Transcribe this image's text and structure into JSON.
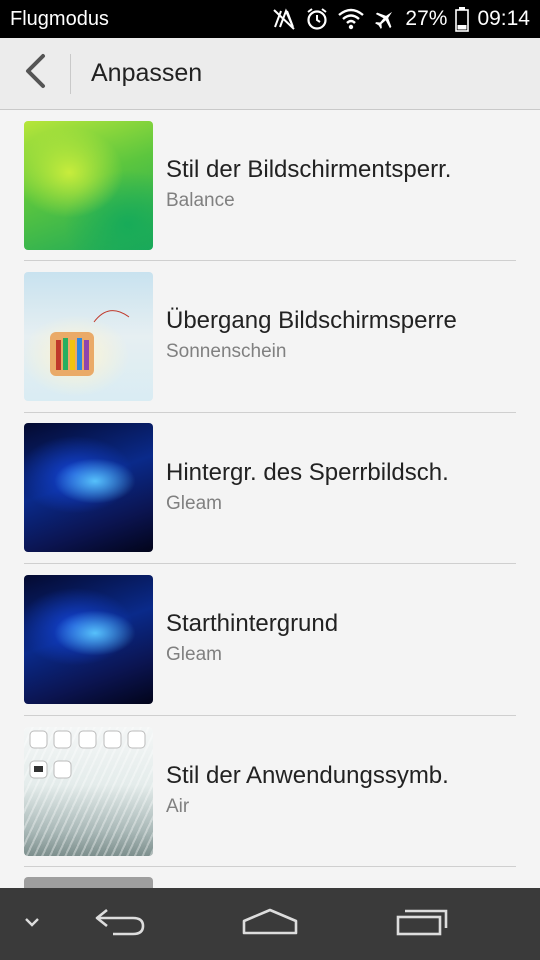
{
  "status_bar": {
    "carrier": "Flugmodus",
    "battery": "27%",
    "time": "09:14",
    "icons": [
      "nfc-icon",
      "alarm-icon",
      "wifi-icon",
      "airplane-icon",
      "battery-icon"
    ]
  },
  "app_bar": {
    "title": "Anpassen",
    "back_icon": "back-arrow-icon"
  },
  "items": [
    {
      "title": "Stil der Bildschirmentsperr.",
      "subtitle": "Balance",
      "thumb": "green-abstract"
    },
    {
      "title": "Übergang Bildschirmsperre",
      "subtitle": "Sonnenschein",
      "thumb": "pencils-sunshine"
    },
    {
      "title": "Hintergr. des Sperrbildsch.",
      "subtitle": "Gleam",
      "thumb": "blue-gleam"
    },
    {
      "title": "Starthintergrund",
      "subtitle": "Gleam",
      "thumb": "blue-gleam"
    },
    {
      "title": "Stil der Anwendungssymb.",
      "subtitle": "Air",
      "thumb": "air-icons"
    }
  ],
  "nav_bar": {
    "buttons": [
      "hide-keyboard-icon",
      "back-icon",
      "home-icon",
      "recents-icon"
    ]
  },
  "colors": {
    "status_bar_bg": "#000000",
    "app_bar_bg": "#ececec",
    "list_bg": "#f4f4f4",
    "nav_bar_bg": "#3a3a3a",
    "title_text": "#222222",
    "subtitle_text": "#808080"
  }
}
